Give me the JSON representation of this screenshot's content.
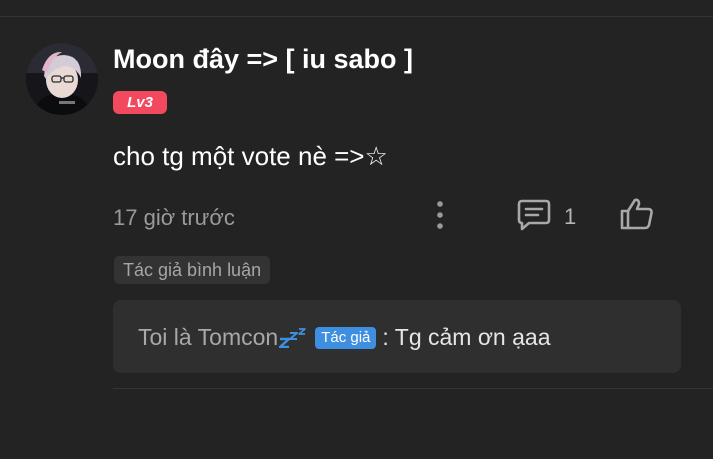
{
  "comment": {
    "username": "Moon đây => [ iu sabo ]",
    "level_badge": "Lv3",
    "text": "cho tg một vote nè =>☆",
    "timestamp": "17 giờ trước",
    "reply_count": "1",
    "author_comment_tag": "Tác giả bình luận"
  },
  "reply": {
    "author": "Toi là Tomcon",
    "author_icon": "sleeping-zzz-icon",
    "author_badge": "Tác giả",
    "text": ": Tg cảm ơn ạaa"
  },
  "icons": {
    "more": "more-vertical-icon",
    "reply": "comment-icon",
    "like": "thumbs-up-icon"
  },
  "colors": {
    "background": "#232323",
    "level_badge": "#f2495f",
    "author_badge": "#3f8fe0",
    "zzz_icon": "#3f8fe0"
  }
}
